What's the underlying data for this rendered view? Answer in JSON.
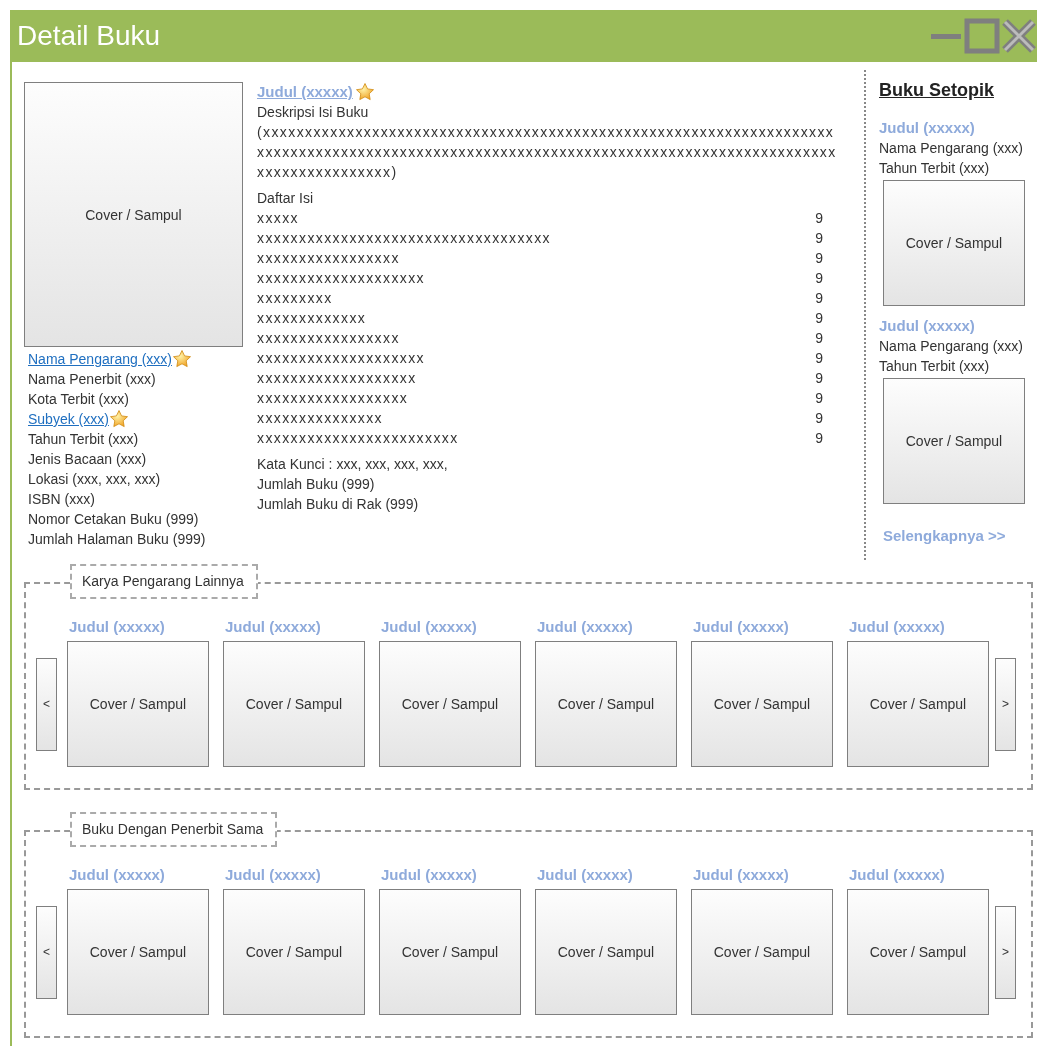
{
  "window": {
    "title": "Detail Buku"
  },
  "book": {
    "cover": "Cover / Sampul",
    "details": [
      {
        "text": "Nama Pengarang (xxx)",
        "kind": "link",
        "starred": true
      },
      {
        "text": "Nama Penerbit (xxx)",
        "kind": "text",
        "starred": false
      },
      {
        "text": "Kota Terbit (xxx)",
        "kind": "text",
        "starred": false
      },
      {
        "text": "Subyek (xxx)",
        "kind": "link",
        "starred": true
      },
      {
        "text": "Tahun Terbit (xxx)",
        "kind": "text",
        "starred": false
      },
      {
        "text": "Jenis Bacaan (xxx)",
        "kind": "text",
        "starred": false
      },
      {
        "text": "Lokasi (xxx, xxx, xxx)",
        "kind": "text",
        "starred": false
      },
      {
        "text": "ISBN (xxx)",
        "kind": "text",
        "starred": false
      },
      {
        "text": "Nomor Cetakan Buku (999)",
        "kind": "text",
        "starred": false
      },
      {
        "text": "Jumlah Halaman Buku (999)",
        "kind": "text",
        "starred": false
      }
    ],
    "title": {
      "text": "Judul (xxxxx)",
      "starred": true
    },
    "description": {
      "heading": "Deskripsi Isi Buku",
      "text": "(xxxxxxxxxxxxxxxxxxxxxxxxxxxxxxxxxxxxxxxxxxxxxxxxxxxxxxxxxxxxxxxxxxxxxxxxxxxxxxxxxxxxxxxxxxxxxxxxxxxxxxxxxxxxxxxxxxxxxxxxxxxxxxxxxxxxxxxxxxxxxxxxxxxxxxxxx)"
    },
    "toc": {
      "heading": "Daftar Isi",
      "entries": [
        {
          "title": "xxxxx",
          "page": "9"
        },
        {
          "title": "xxxxxxxxxxxxxxxxxxxxxxxxxxxxxxxxxxx",
          "page": "9"
        },
        {
          "title": "xxxxxxxxxxxxxxxxx",
          "page": "9"
        },
        {
          "title": "xxxxxxxxxxxxxxxxxxxx",
          "page": "9"
        },
        {
          "title": "xxxxxxxxx",
          "page": "9"
        },
        {
          "title": "xxxxxxxxxxxxx",
          "page": "9"
        },
        {
          "title": "xxxxxxxxxxxxxxxxx",
          "page": "9"
        },
        {
          "title": "xxxxxxxxxxxxxxxxxxxx",
          "page": "9"
        },
        {
          "title": "xxxxxxxxxxxxxxxxxxx",
          "page": "9"
        },
        {
          "title": "xxxxxxxxxxxxxxxxxx",
          "page": "9"
        },
        {
          "title": "xxxxxxxxxxxxxxx",
          "page": "9"
        },
        {
          "title": "xxxxxxxxxxxxxxxxxxxxxxxx",
          "page": "9"
        }
      ]
    },
    "meta": [
      "Kata Kunci : xxx, xxx, xxx, xxx,",
      "Jumlah Buku (999)",
      "Jumlah Buku di Rak (999)"
    ]
  },
  "related": {
    "heading": "Buku Setopik",
    "items": [
      {
        "title": "Judul (xxxxx)",
        "author": "Nama Pengarang (xxx)",
        "year": "Tahun Terbit (xxx)",
        "cover": "Cover / Sampul"
      },
      {
        "title": "Judul (xxxxx)",
        "author": "Nama Pengarang (xxx)",
        "year": "Tahun Terbit (xxx)",
        "cover": "Cover / Sampul"
      }
    ],
    "more": "Selengkapnya >>"
  },
  "carousels": [
    {
      "heading": "Karya Pengarang Lainnya",
      "prev": "<",
      "next": ">",
      "items": [
        {
          "title": "Judul (xxxxx)",
          "cover": "Cover / Sampul"
        },
        {
          "title": "Judul (xxxxx)",
          "cover": "Cover / Sampul"
        },
        {
          "title": "Judul (xxxxx)",
          "cover": "Cover / Sampul"
        },
        {
          "title": "Judul (xxxxx)",
          "cover": "Cover / Sampul"
        },
        {
          "title": "Judul (xxxxx)",
          "cover": "Cover / Sampul"
        },
        {
          "title": "Judul (xxxxx)",
          "cover": "Cover / Sampul"
        }
      ]
    },
    {
      "heading": "Buku Dengan Penerbit Sama",
      "prev": "<",
      "next": ">",
      "items": [
        {
          "title": "Judul (xxxxx)",
          "cover": "Cover / Sampul"
        },
        {
          "title": "Judul (xxxxx)",
          "cover": "Cover / Sampul"
        },
        {
          "title": "Judul (xxxxx)",
          "cover": "Cover / Sampul"
        },
        {
          "title": "Judul (xxxxx)",
          "cover": "Cover / Sampul"
        },
        {
          "title": "Judul (xxxxx)",
          "cover": "Cover / Sampul"
        },
        {
          "title": "Judul (xxxxx)",
          "cover": "Cover / Sampul"
        }
      ]
    }
  ]
}
